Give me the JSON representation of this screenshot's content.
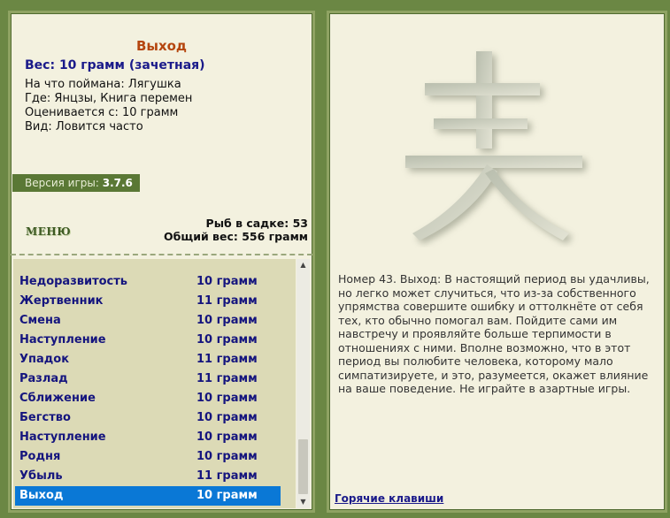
{
  "fish": {
    "title": "Выход",
    "weight": "Вес: 10 грамм (зачетная)",
    "caught_on": "На что поймана: Лягушка",
    "where": "Где: Янцзы, Книга перемен",
    "valued_from": "Оценивается с: 10 грамм",
    "type": "Вид: Ловится часто"
  },
  "version": {
    "label": "Версия игры:",
    "value": "3.7.6"
  },
  "menu_label": "МЕНЮ",
  "stats": {
    "fish_in_cage": "Рыб в садке: 53",
    "total_weight": "Общий вес: 556 грамм"
  },
  "catch_list": [
    {
      "name": "Недоразвитость",
      "weight": "10 грамм"
    },
    {
      "name": "Жертвенник",
      "weight": "11 грамм"
    },
    {
      "name": "Смена",
      "weight": "10 грамм"
    },
    {
      "name": "Наступление",
      "weight": "10 грамм"
    },
    {
      "name": "Упадок",
      "weight": "11 грамм"
    },
    {
      "name": "Разлад",
      "weight": "11 грамм"
    },
    {
      "name": "Сближение",
      "weight": "10 грамм"
    },
    {
      "name": "Бегство",
      "weight": "10 грамм"
    },
    {
      "name": "Наступление",
      "weight": "10 грамм"
    },
    {
      "name": "Родня",
      "weight": "10 грамм"
    },
    {
      "name": "Убыль",
      "weight": "11 грамм"
    },
    {
      "name": "Выход",
      "weight": "10 грамм"
    }
  ],
  "selected_index": 11,
  "description": "Номер 43. Выход: В настоящий период вы удачливы, но легко может случиться, что из-за собственного упрямства совершите ошибку и оттолкнёте от себя тех, кто обычно помогал вам. Пойдите сами им навстречу и проявляйте больше терпимости в отношениях с ними. Вполне возможно, что в этот период вы полюбите человека, которому мало симпатизируете, и это, разумеется, окажет влияние на ваше поведение. Не играйте в азартные игры.",
  "hotkeys_label": "Горячие клавиши",
  "colors": {
    "background": "#6b8744",
    "panel": "#f3f1df",
    "list_bg": "#dcdab6",
    "selection": "#0a78d6",
    "text_blue": "#1a1a8a",
    "title_orange": "#b5460f"
  }
}
